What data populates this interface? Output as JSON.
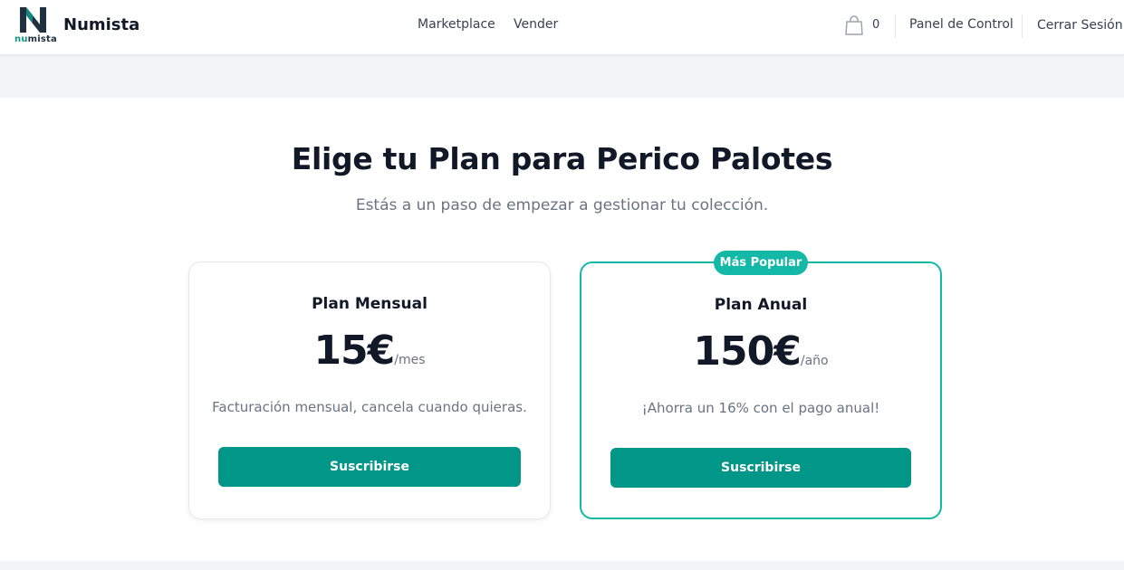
{
  "header": {
    "logo_text_prefix": "nu",
    "logo_text_suffix": "mista",
    "brand": "Numista",
    "nav": {
      "marketplace": "Marketplace",
      "sell": "Vender"
    },
    "cart_count": "0",
    "dashboard": "Panel de Control",
    "logout": "Cerrar Sesión"
  },
  "main": {
    "title": "Elige tu Plan para Perico Palotes",
    "subtitle": "Estás a un paso de empezar a gestionar tu colección."
  },
  "plans": {
    "monthly": {
      "name": "Plan Mensual",
      "price": "15€",
      "period": "/mes",
      "description": "Facturación mensual, cancela cuando quieras.",
      "cta": "Suscribirse"
    },
    "annual": {
      "badge": "Más Popular",
      "name": "Plan Anual",
      "price": "150€",
      "period": "/año",
      "description": "¡Ahorra un 16% con el pago anual!",
      "cta": "Suscribirse"
    }
  },
  "colors": {
    "primary": "#009688",
    "accent": "#14b8a6",
    "logo_dark": "#1f3140"
  },
  "icons": {
    "logo": "numista-logo-icon",
    "cart": "shopping-bag-icon"
  }
}
